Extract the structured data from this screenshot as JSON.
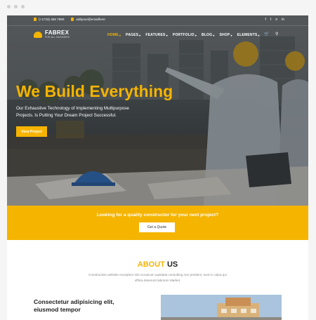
{
  "topbar": {
    "phone": "(+1723) 456 7890",
    "email": "addyour@emailhere",
    "social_icons": [
      "facebook-icon",
      "twitter-icon",
      "instagram-icon",
      "linkedin-icon"
    ],
    "social_glyphs": [
      "f",
      "t",
      "o",
      "in"
    ]
  },
  "brand": {
    "name": "FABREX",
    "tagline": "FOR ALL BUSINESS",
    "accent_color": "#f5b400"
  },
  "nav": {
    "items": [
      {
        "label": "HOME",
        "active": true
      },
      {
        "label": "PAGES",
        "active": false
      },
      {
        "label": "FEATURES",
        "active": false
      },
      {
        "label": "PORTFOLIO",
        "active": false
      },
      {
        "label": "BLOG",
        "active": false
      },
      {
        "label": "SHOP",
        "active": false
      },
      {
        "label": "ELEMENTS",
        "active": false
      }
    ],
    "cart_icon": "cart-icon",
    "search_icon": "search-icon"
  },
  "hero": {
    "headline": "We Build Everything",
    "subline": "Our Exhaustive Technology of Implementing Multipurpose Projects. Is Putting Your Dream Project Successful.",
    "button_label": "View Project"
  },
  "cta": {
    "text": "Looking for a quality constructor for your next project?",
    "button_label": "Get a Quote"
  },
  "about": {
    "title_accent": "ABOUT",
    "title_rest": "US",
    "description": "Construction website excepteur sint occaecat cupidatat consulting non proident, sunt in culpa qui officia deserunt laborum Market.",
    "feature_title": "Consectetur adipisicing elit, eiusmod tempor"
  }
}
